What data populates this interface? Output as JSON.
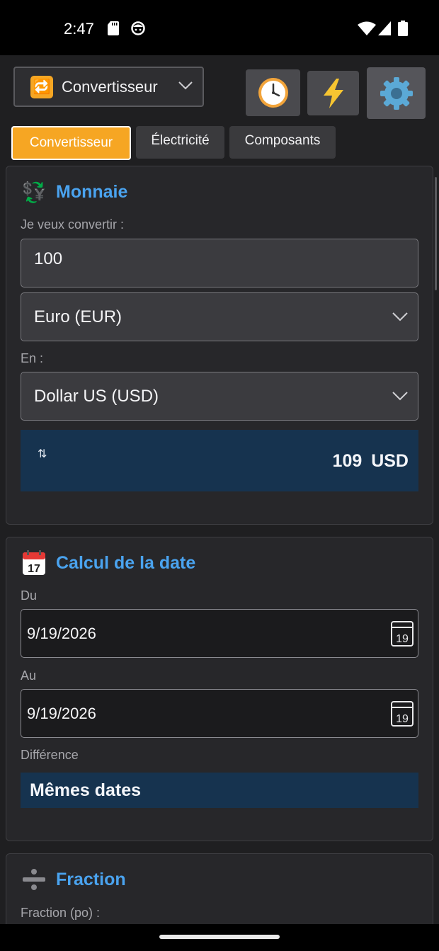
{
  "status": {
    "time": "2:47"
  },
  "header": {
    "dropdown_emoji": "🔁",
    "dropdown_label": "Convertisseur",
    "buttons": [
      {
        "icon": "clock-icon",
        "glyph": "🕓"
      },
      {
        "icon": "lightning-icon",
        "glyph": "⚡"
      },
      {
        "icon": "gear-icon",
        "glyph": "⚙️"
      }
    ]
  },
  "tabs": [
    {
      "label": "Convertisseur",
      "active": true
    },
    {
      "label": "Électricité",
      "active": false
    },
    {
      "label": "Composants",
      "active": false
    }
  ],
  "monnaie": {
    "icon": "💱",
    "title": "Monnaie",
    "from_label": "Je veux convertir :",
    "amount": "100",
    "from_currency": "Euro (EUR)",
    "to_label": "En :",
    "to_currency": "Dollar US (USD)",
    "swap_glyph": "⇅",
    "result": "109 USD"
  },
  "date_calc": {
    "icon": "📅",
    "title": "Calcul de la date",
    "from_label": "Du",
    "from_date": "9/19/2026",
    "to_label": "Au",
    "to_date": "9/19/2026",
    "diff_label": "Différence",
    "diff_value": "Mêmes dates"
  },
  "fraction": {
    "icon": "➗",
    "title": "Fraction",
    "label": "Fraction (po) :"
  },
  "colors": {
    "accent": "#f6a623",
    "title_blue": "#4aa3ef",
    "result_bg": "#16334f"
  }
}
